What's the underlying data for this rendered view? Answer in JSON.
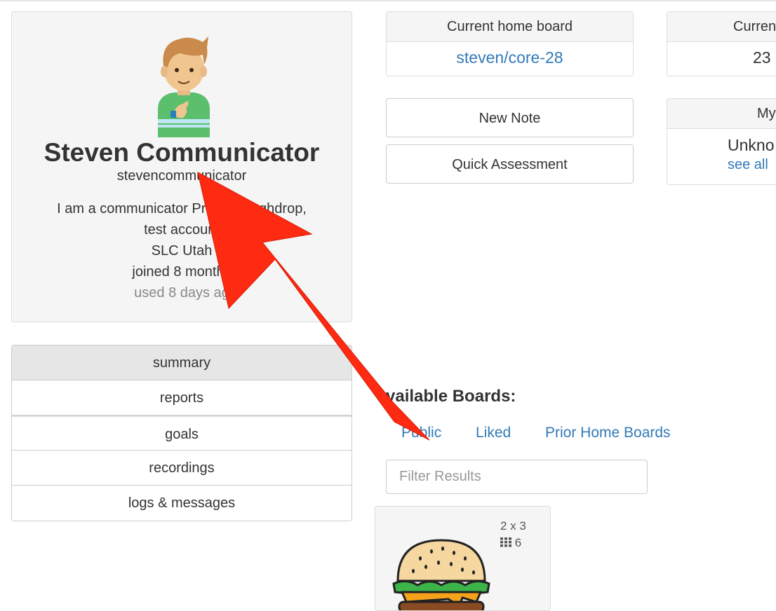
{
  "profile": {
    "name": "Steven Communicator",
    "username": "stevencommunicator",
    "bio_line1": "I am a communicator Pro",
    "bio_line1b": "to Coughdrop,",
    "bio_line2": "test account",
    "location": "SLC Utah",
    "joined": "joined 8 months",
    "used": "used 8 days ag"
  },
  "nav": {
    "items": [
      {
        "label": "summary"
      },
      {
        "label": "reports"
      },
      {
        "label": "goals"
      },
      {
        "label": "recordings"
      },
      {
        "label": "logs & messages"
      }
    ]
  },
  "home_board": {
    "header": "Current home board",
    "value": "steven/core-28"
  },
  "current_panel": {
    "header": "Curren",
    "value": "23"
  },
  "my_panel": {
    "header": "My",
    "value": "Unkno",
    "link": "see all"
  },
  "actions": {
    "new_note": "New Note",
    "quick_assessment": "Quick Assessment"
  },
  "boards": {
    "title": "vailable Boards:",
    "tabs": [
      {
        "label": "Public"
      },
      {
        "label": "Liked"
      },
      {
        "label": "Prior Home Boards"
      }
    ],
    "filter_placeholder": "Filter Results",
    "tile": {
      "grid": "2 x 3",
      "count": "6"
    }
  },
  "colors": {
    "link": "#337ab7",
    "arrow": "#ff2a12",
    "panel_bg": "#f5f5f5"
  },
  "icons": [
    "avatar-icon",
    "grid-icon",
    "hamburger-board-icon",
    "annotation-arrow"
  ]
}
